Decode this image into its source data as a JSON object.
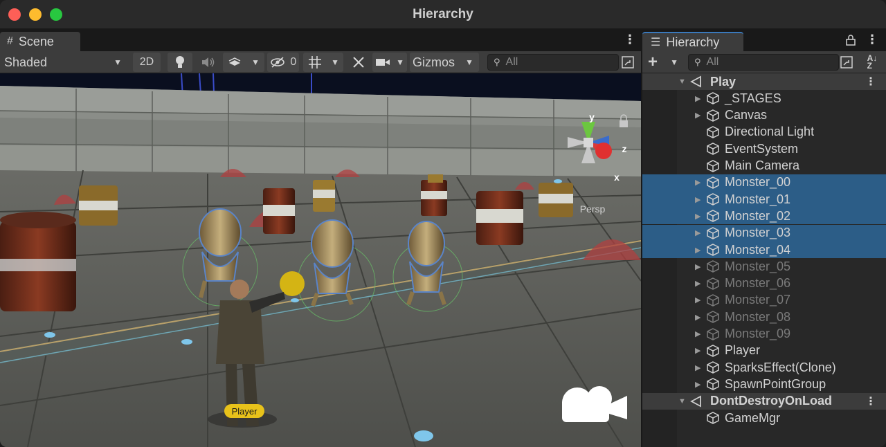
{
  "window": {
    "title": "Hierarchy"
  },
  "scene_panel": {
    "tab_label": "Scene",
    "toolbar": {
      "shading_mode": "Shaded",
      "view_2d_label": "2D",
      "hidden_count": "0",
      "gizmos_label": "Gizmos",
      "search_placeholder": "All"
    },
    "viewport": {
      "gizmo_axes": [
        "y",
        "z",
        "x"
      ],
      "projection_label": "Persp",
      "player_tag": "Player"
    }
  },
  "hierarchy_panel": {
    "tab_label": "Hierarchy",
    "search_placeholder": "All",
    "rows": [
      {
        "label": "Play",
        "kind": "scene",
        "expanded": true
      },
      {
        "label": "_STAGES",
        "kind": "object",
        "has_children": true,
        "selected": false,
        "active": true
      },
      {
        "label": "Canvas",
        "kind": "object",
        "has_children": true,
        "selected": false,
        "active": true
      },
      {
        "label": "Directional Light",
        "kind": "object",
        "has_children": false,
        "selected": false,
        "active": true
      },
      {
        "label": "EventSystem",
        "kind": "object",
        "has_children": false,
        "selected": false,
        "active": true
      },
      {
        "label": "Main Camera",
        "kind": "object",
        "has_children": false,
        "selected": false,
        "active": true
      },
      {
        "label": "Monster_00",
        "kind": "object",
        "has_children": true,
        "selected": true,
        "active": true
      },
      {
        "label": "Monster_01",
        "kind": "object",
        "has_children": true,
        "selected": true,
        "active": true
      },
      {
        "label": "Monster_02",
        "kind": "object",
        "has_children": true,
        "selected": true,
        "active": true
      },
      {
        "label": "Monster_03",
        "kind": "object",
        "has_children": true,
        "selected": true,
        "active": true
      },
      {
        "label": "Monster_04",
        "kind": "object",
        "has_children": true,
        "selected": true,
        "active": true
      },
      {
        "label": "Monster_05",
        "kind": "object",
        "has_children": true,
        "selected": false,
        "active": false
      },
      {
        "label": "Monster_06",
        "kind": "object",
        "has_children": true,
        "selected": false,
        "active": false
      },
      {
        "label": "Monster_07",
        "kind": "object",
        "has_children": true,
        "selected": false,
        "active": false
      },
      {
        "label": "Monster_08",
        "kind": "object",
        "has_children": true,
        "selected": false,
        "active": false
      },
      {
        "label": "Monster_09",
        "kind": "object",
        "has_children": true,
        "selected": false,
        "active": false
      },
      {
        "label": "Player",
        "kind": "object",
        "has_children": true,
        "selected": false,
        "active": true
      },
      {
        "label": "SparksEffect(Clone)",
        "kind": "object",
        "has_children": true,
        "selected": false,
        "active": true
      },
      {
        "label": "SpawnPointGroup",
        "kind": "object",
        "has_children": true,
        "selected": false,
        "active": true
      },
      {
        "label": "DontDestroyOnLoad",
        "kind": "scene",
        "expanded": true
      },
      {
        "label": "GameMgr",
        "kind": "object",
        "has_children": false,
        "selected": false,
        "active": true
      }
    ]
  },
  "colors": {
    "selection": "#2c5d87",
    "tab_accent": "#3a79bb",
    "inactive_text": "#7a7a7a",
    "traffic_close": "#fe5f57",
    "traffic_min": "#febc2e",
    "traffic_max": "#28c840"
  }
}
